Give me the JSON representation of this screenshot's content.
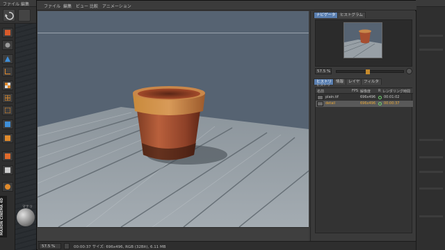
{
  "bg_menubar": {
    "items": [
      "ファイル",
      "編集"
    ]
  },
  "bg_editor_label": "編集",
  "maxon_logo": "MAXON CINEMA 4D",
  "material_label": "マテリ",
  "render_window": {
    "menu": [
      "ファイル",
      "編集",
      "ビュー",
      "比較",
      "アニメーション"
    ],
    "statusbar": {
      "zoom": "57.5 %",
      "text": "00:00:37   サイズ: 696x496, RGB (32Bit), 6.11 MB"
    },
    "panel": {
      "tabs_top": [
        "ナビゲータ",
        "ヒストグラム"
      ],
      "zoom": "57.5 %",
      "tabs_mid": [
        "ヒストリ",
        "情報",
        "レイヤ",
        "フィルタ"
      ],
      "history": {
        "section_label": "ヒストリ",
        "columns": [
          "名前",
          "FPS",
          "解像度",
          "R",
          "レンダリング時間"
        ],
        "rows": [
          {
            "name": "plain.tif",
            "res": "696x496",
            "time": "00:01:02",
            "selected": false
          },
          {
            "name": "detail",
            "res": "696x496",
            "time": "00:00:37",
            "selected": true
          }
        ]
      }
    }
  },
  "colors": {
    "accent_tab": "#5a7fb0",
    "selected_text": "#e8a838",
    "status_ok": "#6fd36f"
  },
  "icons": [
    "undo-icon",
    "move-icon",
    "scale-icon",
    "rotate-icon",
    "window-controls-icon",
    "zoom-plus-icon"
  ]
}
